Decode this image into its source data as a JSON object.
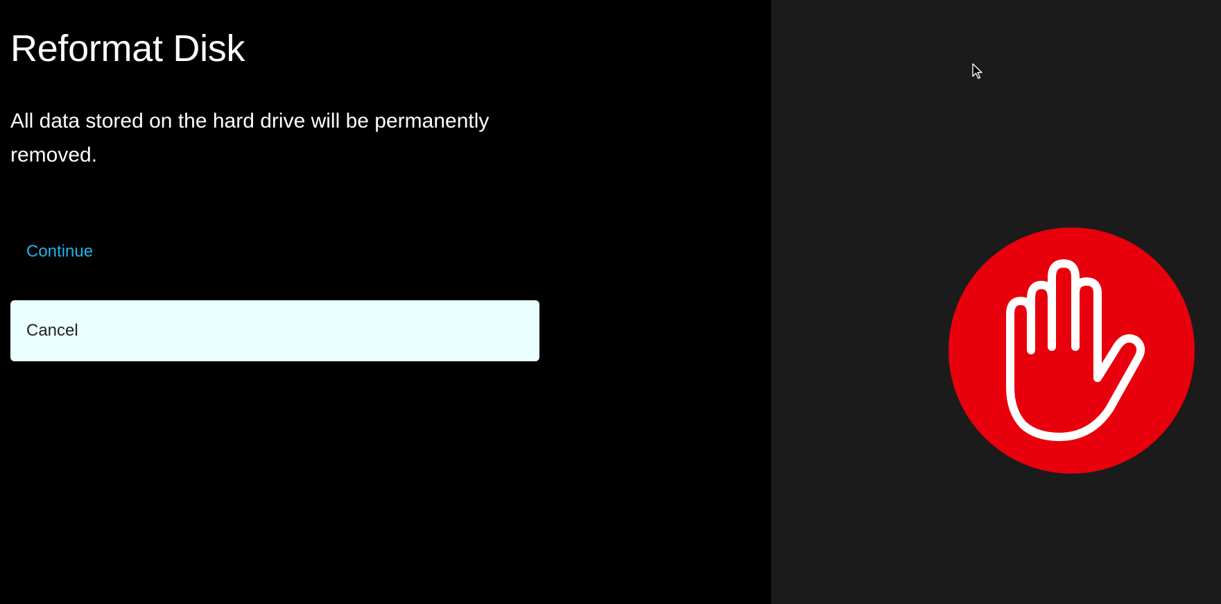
{
  "dialog": {
    "title": "Reformat Disk",
    "message": "All data stored on the hard drive will be permanently removed.",
    "continue_label": "Continue",
    "cancel_label": "Cancel"
  },
  "icons": {
    "warning": "stop-hand-icon",
    "pointer": "mouse-cursor-icon"
  },
  "colors": {
    "background_left": "#000000",
    "background_right": "#1b1b1b",
    "text": "#ffffff",
    "link_accent": "#22b3ea",
    "cancel_bg": "#eaffff",
    "cancel_text": "#222222",
    "stop_red": "#e8000c"
  }
}
